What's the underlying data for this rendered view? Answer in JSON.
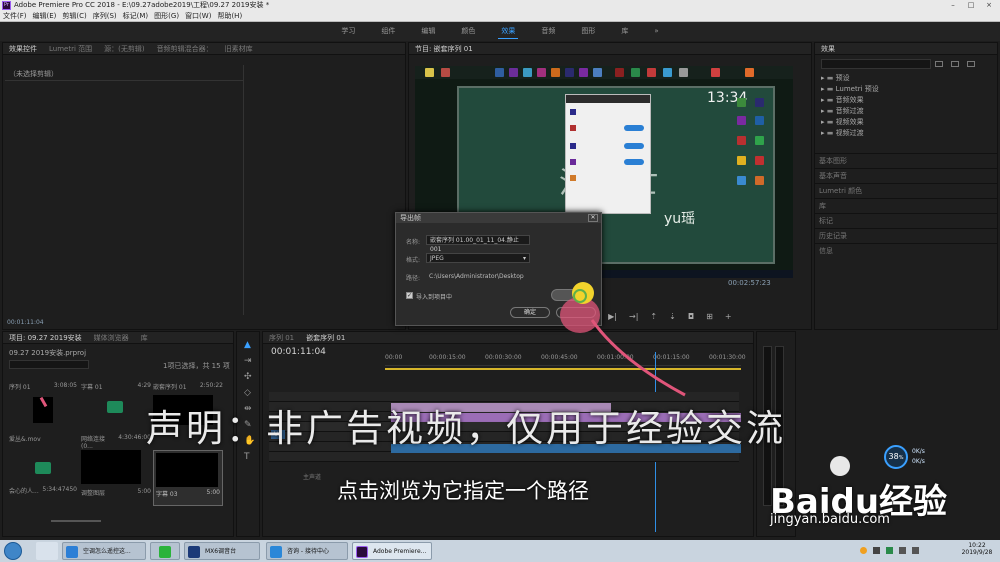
{
  "titlebar": {
    "text": "Adobe Premiere Pro CC 2018 - E:\\09.27adobe2019\\工程\\09.27 2019安装 *"
  },
  "menubar": [
    "文件(F)",
    "编辑(E)",
    "剪辑(C)",
    "序列(S)",
    "标记(M)",
    "图形(G)",
    "窗口(W)",
    "帮助(H)"
  ],
  "workspaces": [
    "学习",
    "组件",
    "编辑",
    "颜色",
    "效果",
    "音频",
    "图形",
    "库"
  ],
  "workspace_more": "»",
  "source_panel": {
    "tabs": [
      "效果控件",
      "Lumetri 范围",
      "源：(无剪辑)",
      "音频剪辑混合器：",
      "旧素材库"
    ],
    "placeholder": "（未选择剪辑）",
    "timecode": "00:01:11:04"
  },
  "program_panel": {
    "tab": "节目: 嵌套序列 01",
    "timecode_right": "00:02:57:23",
    "desktop_clock": "13:34",
    "handwriting": "yu瑶"
  },
  "export_dialog": {
    "title": "导出帧",
    "name_label": "名称:",
    "name_value": "嵌套序列 01.00_01_11_04.静止001",
    "format_label": "格式:",
    "format_value": "JPEG",
    "path_label": "路径:",
    "path_value": "C:\\Users\\Administrator\\Desktop",
    "import_label": "导入到项目中",
    "ok_label": "确定"
  },
  "effects_panel": {
    "items": [
      "预设",
      "Lumetri 预设",
      "音频效果",
      "音频过渡",
      "视频效果",
      "视频过渡"
    ],
    "sections": [
      "基本图形",
      "基本声音",
      "Lumetri 颜色",
      "库",
      "标记",
      "历史记录",
      "信息"
    ]
  },
  "project_panel": {
    "tabs": [
      "项目: 09.27 2019安装",
      "媒体浏览器",
      "库"
    ],
    "project_file": "09.27 2019安装.prproj",
    "selection": "1项已选择，共 15 项",
    "clips": [
      {
        "name": "序列 01",
        "duration": "3:08:05"
      },
      {
        "name": "字幕 01",
        "duration": "4:29"
      },
      {
        "name": "嵌套序列 01",
        "duration": "2:50:22"
      },
      {
        "name": "爱丛&.mov",
        "duration": ""
      },
      {
        "name": "网络连接 (0...",
        "duration": "4:30:46:00"
      },
      {
        "name": "字幕 02",
        "duration": ""
      },
      {
        "name": "会心的人...",
        "duration": "5:34:47450"
      },
      {
        "name": "调整图层",
        "duration": "5:00"
      },
      {
        "name": "字幕 03",
        "duration": "5:00"
      }
    ]
  },
  "timeline": {
    "tabs": [
      "序列 01",
      "嵌套序列 01"
    ],
    "timecode": "00:01:11:04",
    "ruler": [
      "00:00",
      "00:00:15:00",
      "00:00:30:00",
      "00:00:45:00",
      "00:01:00:00",
      "00:01:15:00",
      "00:01:30:00"
    ],
    "master": "主声道",
    "track_v1": "V1"
  },
  "overlay": {
    "disclaimer": "声明：非广告视频，仅用于经验交流",
    "subtitle": "点击浏览为它指定一个路径"
  },
  "net_widget": {
    "percent": "38",
    "percent_unit": "%",
    "up": "0",
    "down": "0",
    "unit": "K/s"
  },
  "watermark": {
    "brand": "Baidu经验",
    "url": "jingyan.baidu.com"
  },
  "taskbar": {
    "items": [
      "空调怎么遥控这...",
      "",
      "MX6调音台",
      "咨询 - 接待中心",
      "Adobe Premiere..."
    ],
    "time": "10:22",
    "date": "2019/9/28"
  },
  "colors": {
    "accent": "#3aa0ff",
    "cursor_pink": "#e0557a",
    "cursor_yellow": "#f2d32c"
  }
}
